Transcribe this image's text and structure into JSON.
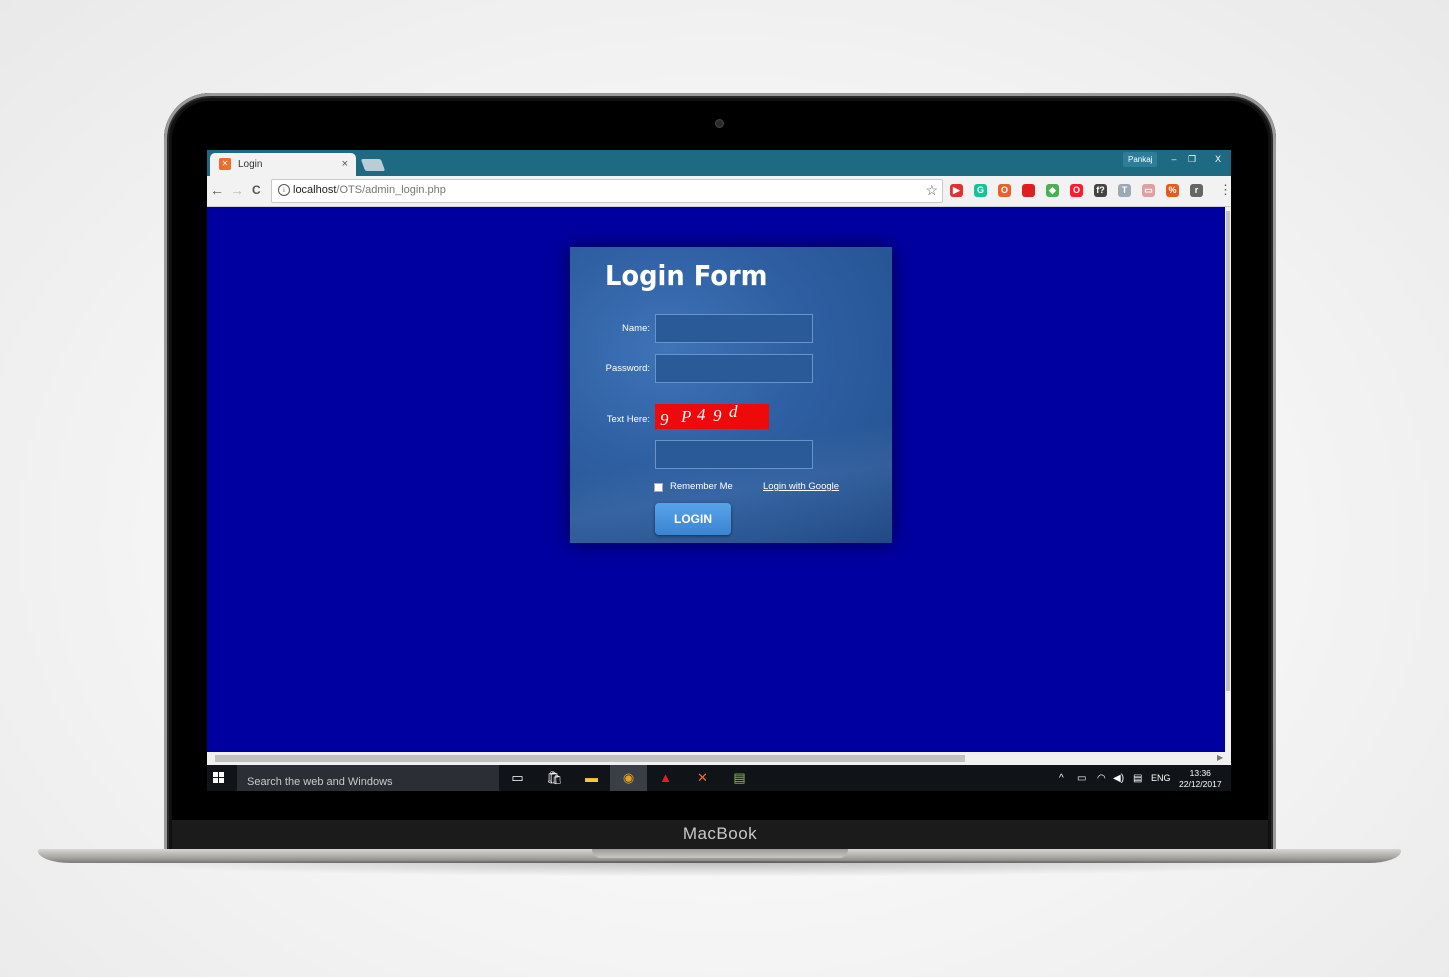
{
  "device": {
    "brand_label": "MacBook"
  },
  "browser": {
    "tab": {
      "title": "Login",
      "close": "×",
      "favicon_color": "#ef6c2c"
    },
    "profile_label": "Pankaj",
    "window_controls": {
      "minimize": "–",
      "restore": "❐",
      "close": "X"
    },
    "nav": {
      "back": "←",
      "forward": "→",
      "reload": "C"
    },
    "address": {
      "host": "localhost",
      "path": "/OTS/admin_login.php"
    },
    "bookmark_star": "☆",
    "extensions": [
      {
        "name": "video-ext",
        "glyph": "▶",
        "color": "#e03030"
      },
      {
        "name": "grammarly-ext",
        "glyph": "G",
        "color": "#15c39a"
      },
      {
        "name": "office-ext",
        "glyph": "O",
        "color": "#e8612c"
      },
      {
        "name": "bookmark-ext",
        "glyph": "",
        "color": "#e02020"
      },
      {
        "name": "colorful-ext",
        "glyph": "◆",
        "color": "#4caf50"
      },
      {
        "name": "opera-ext",
        "glyph": "O",
        "color": "#ff1b2d"
      },
      {
        "name": "formula-ext",
        "glyph": "f?",
        "color": "#444444"
      },
      {
        "name": "text-ext",
        "glyph": "T",
        "color": "#9aa8b8"
      },
      {
        "name": "calendar-ext",
        "glyph": "▭",
        "color": "#e0a0a0"
      },
      {
        "name": "percent-ext",
        "glyph": "%",
        "color": "#e85a1a"
      },
      {
        "name": "r-ext",
        "glyph": "r",
        "color": "#666666"
      }
    ],
    "menu": "⋮"
  },
  "page": {
    "background": "#0000a0",
    "login_form": {
      "title": "Login Form",
      "name_label": "Name:",
      "name_value": "",
      "password_label": "Password:",
      "password_value": "",
      "captcha_label": "Text Here:",
      "captcha_chars": [
        "9",
        "P",
        "4",
        "9",
        "d"
      ],
      "captcha_input_value": "",
      "remember_label": "Remember Me",
      "google_link": "Login with Google",
      "login_button": "LOGIN"
    }
  },
  "taskbar": {
    "search_placeholder": "Search the web and Windows",
    "language": "ENG",
    "time": "13:36",
    "date": "22/12/2017"
  }
}
